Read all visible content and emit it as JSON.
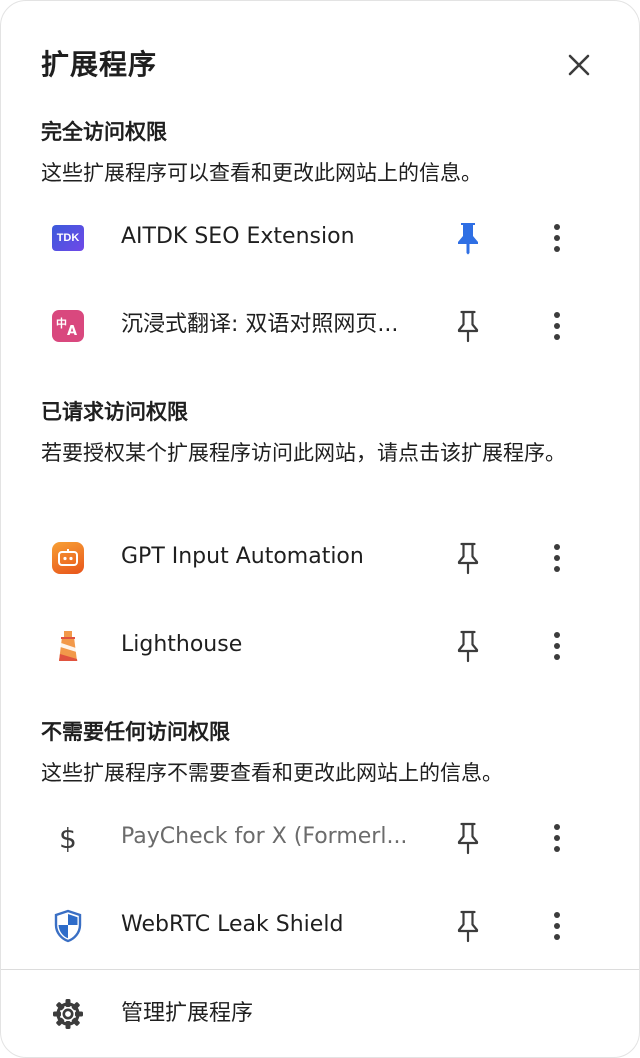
{
  "header": {
    "title": "扩展程序",
    "close_icon": "close-icon"
  },
  "sections": {
    "full_access": {
      "title": "完全访问权限",
      "description": "这些扩展程序可以查看和更改此网站上的信息。"
    },
    "requested_access": {
      "title": "已请求访问权限",
      "description": "若要授权某个扩展程序访问此网站，请点击该扩展程序。"
    },
    "no_access": {
      "title": "不需要任何访问权限",
      "description": "这些扩展程序不需要查看和更改此网站上的信息。"
    }
  },
  "extensions": {
    "aitdk": {
      "name": "AITDK SEO Extension",
      "icon_text": "TDK",
      "pinned": true
    },
    "immersive": {
      "name": "沉浸式翻译: 双语对照网页...",
      "icon_text": "中A",
      "pinned": false
    },
    "gpt": {
      "name": "GPT Input Automation",
      "pinned": false
    },
    "lighthouse": {
      "name": "Lighthouse",
      "pinned": false
    },
    "paycheck": {
      "name": "PayCheck for X (Formerl...",
      "pinned": false
    },
    "webrtc": {
      "name": "WebRTC Leak Shield",
      "pinned": false
    }
  },
  "footer": {
    "label": "管理扩展程序",
    "icon": "gear-icon"
  },
  "colors": {
    "pinned_blue": "#2f6fe4",
    "icon_dark": "#3c3c3c",
    "divider": "#dcdcdc"
  }
}
